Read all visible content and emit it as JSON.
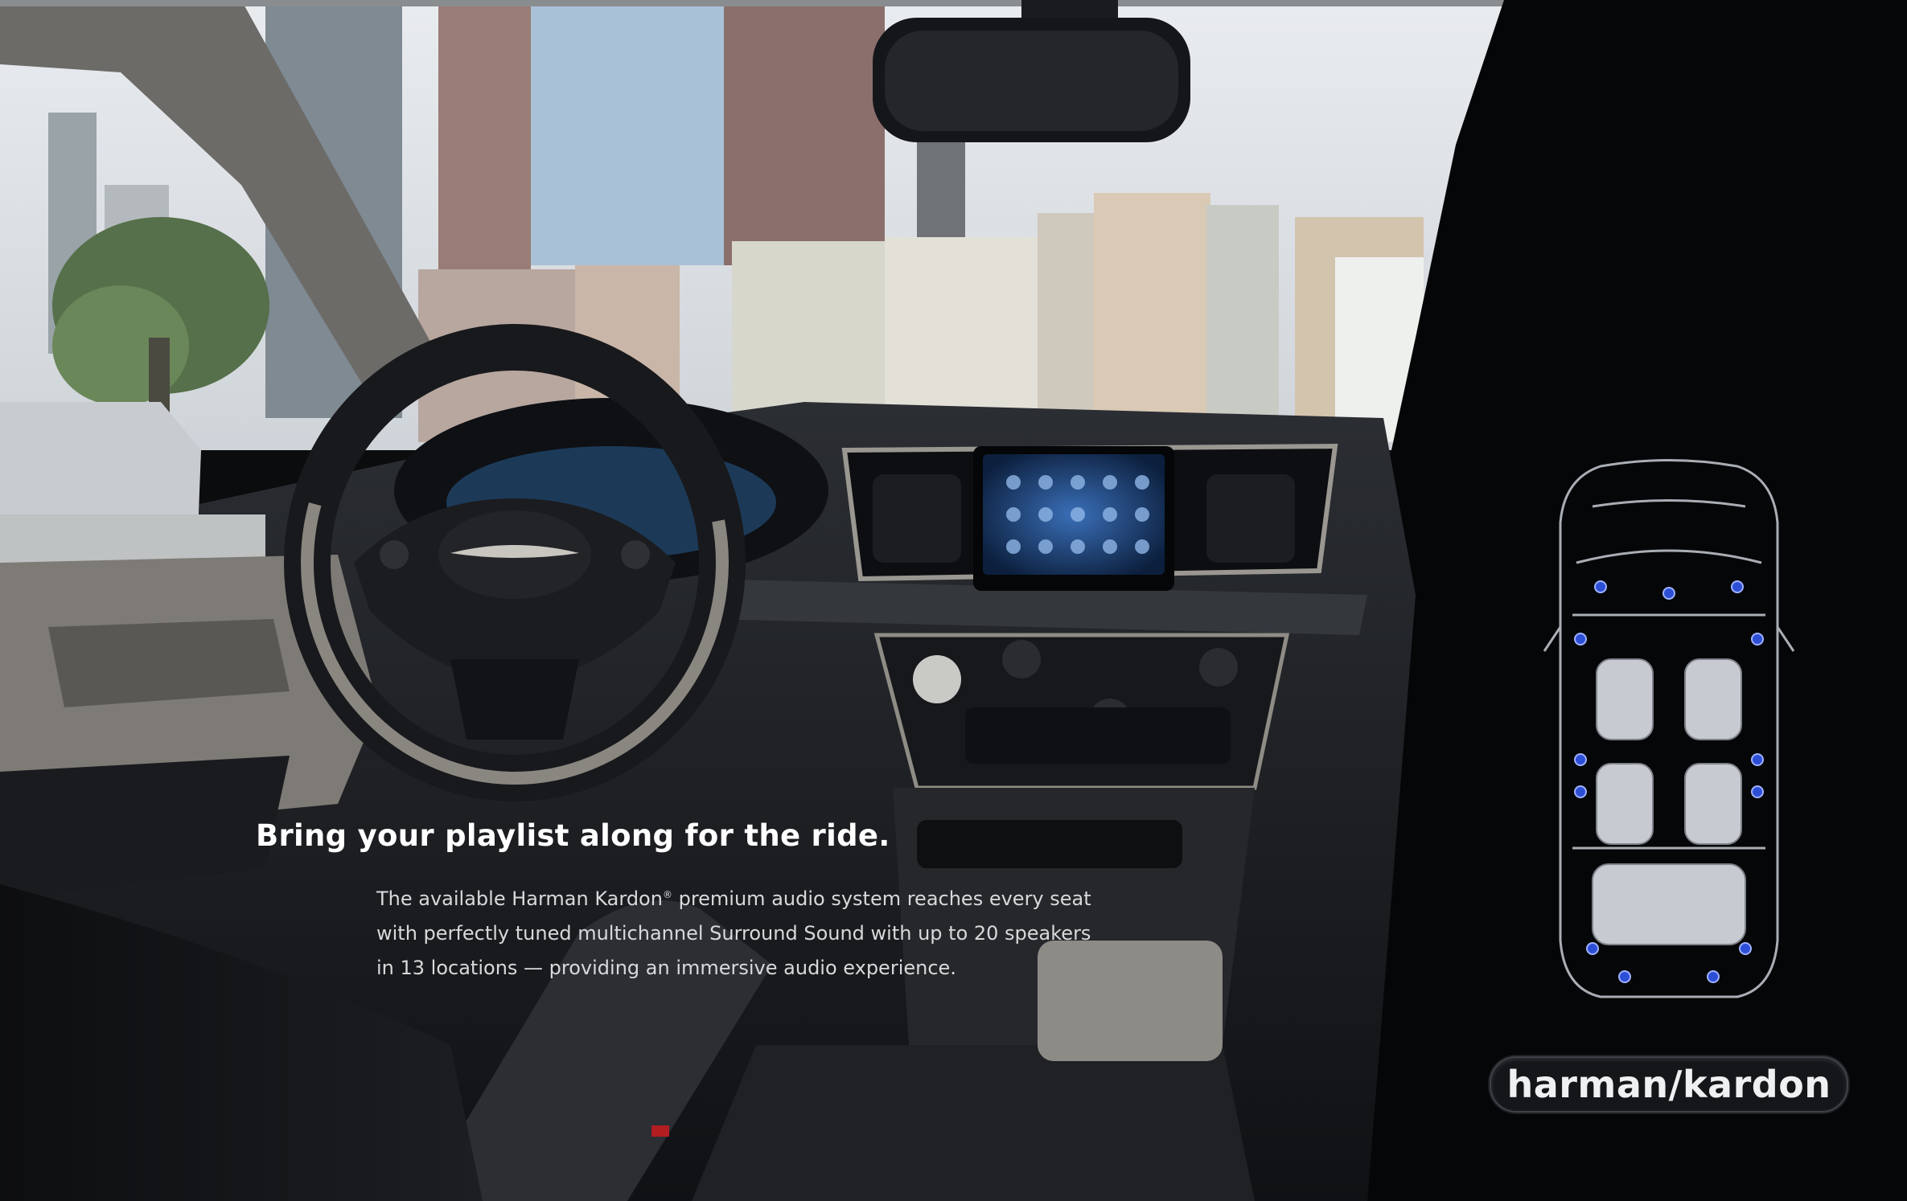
{
  "headline": "Bring your playlist along for the ride.",
  "body_lines": [
    "The available Harman Kardon",
    " premium audio system reaches every seat",
    "with perfectly tuned multichannel Surround Sound with up to 20 speakers",
    "in 13 locations — providing an immersive audio experience."
  ],
  "registered_mark": "®",
  "brand_logo": "harman/kardon",
  "colors": {
    "background": "#0b0c0e",
    "headline": "#ffffff",
    "body": "#d8d9db",
    "speaker_dot": "#2d4fd6"
  },
  "icons": {
    "vehicle_diagram": "minivan-top-view-speaker-layout",
    "steering_wheel": "steering-wheel",
    "infotainment": "touchscreen-display"
  }
}
